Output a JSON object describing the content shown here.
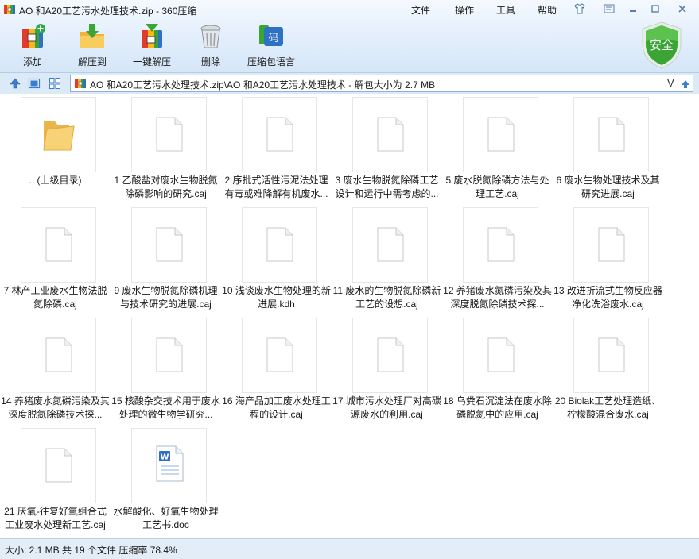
{
  "window": {
    "title": "AO 和A20工艺污水处理技术.zip - 360压缩"
  },
  "menu": [
    "文件",
    "操作",
    "工具",
    "帮助"
  ],
  "toolbar": [
    {
      "label": "添加",
      "icon": "add-archive-icon"
    },
    {
      "label": "解压到",
      "icon": "extract-folder-icon"
    },
    {
      "label": "一键解压",
      "icon": "quick-extract-icon"
    },
    {
      "label": "删除",
      "icon": "trash-icon"
    },
    {
      "label": "压缩包语言",
      "icon": "language-icon"
    }
  ],
  "security": {
    "label": "安全",
    "color": "#3aa535"
  },
  "address": {
    "path": "AO 和A20工艺污水处理技术.zip\\AO 和A20工艺污水处理技术 - 解包大小为 2.7 MB",
    "dropdown": "V"
  },
  "files": [
    {
      "name": ".. (上级目录)",
      "type": "folder"
    },
    {
      "name": "1  乙酸盐对废水生物脱氮除磷影响的研究.caj",
      "type": "file"
    },
    {
      "name": "2  序批式活性污泥法处理有毒或难降解有机废水...",
      "type": "file"
    },
    {
      "name": "3  废水生物脱氮除磷工艺设计和运行中需考虑的...",
      "type": "file"
    },
    {
      "name": "5  废水脱氮除磷方法与处理工艺.caj",
      "type": "file"
    },
    {
      "name": "6  废水生物处理技术及其研究进展.caj",
      "type": "file"
    },
    {
      "name": "7  林产工业废水生物法脱氮除磷.caj",
      "type": "file"
    },
    {
      "name": "9  废水生物脱氮除磷机理与技术研究的进展.caj",
      "type": "file"
    },
    {
      "name": "10  浅谈废水生物处理的新进展.kdh",
      "type": "file"
    },
    {
      "name": "11  废水的生物脱氮除磷新工艺的设想.caj",
      "type": "file"
    },
    {
      "name": "12  养猪废水氮磷污染及其深度脱氮除磷技术探...",
      "type": "file"
    },
    {
      "name": "13  改进折流式生物反应器净化洗浴废水.caj",
      "type": "file"
    },
    {
      "name": "14  养猪废水氮磷污染及其深度脱氮除磷技术探...",
      "type": "file"
    },
    {
      "name": "15  核酸杂交技术用于废水处理的微生物学研究...",
      "type": "file"
    },
    {
      "name": "16  海产品加工废水处理工程的设计.caj",
      "type": "file"
    },
    {
      "name": "17  城市污水处理厂对高碳源废水的利用.caj",
      "type": "file"
    },
    {
      "name": "18  鸟粪石沉淀法在废水除磷脱氮中的应用.caj",
      "type": "file"
    },
    {
      "name": "20  Biolak工艺处理造纸、柠檬酸混合废水.caj",
      "type": "file"
    },
    {
      "name": "21  厌氧-往复好氧组合式工业废水处理新工艺.caj",
      "type": "file"
    },
    {
      "name": "水解酸化、好氧生物处理工艺书.doc",
      "type": "doc"
    }
  ],
  "status": {
    "text": "大小: 2.1 MB 共 19 个文件 压缩率 78.4%"
  }
}
